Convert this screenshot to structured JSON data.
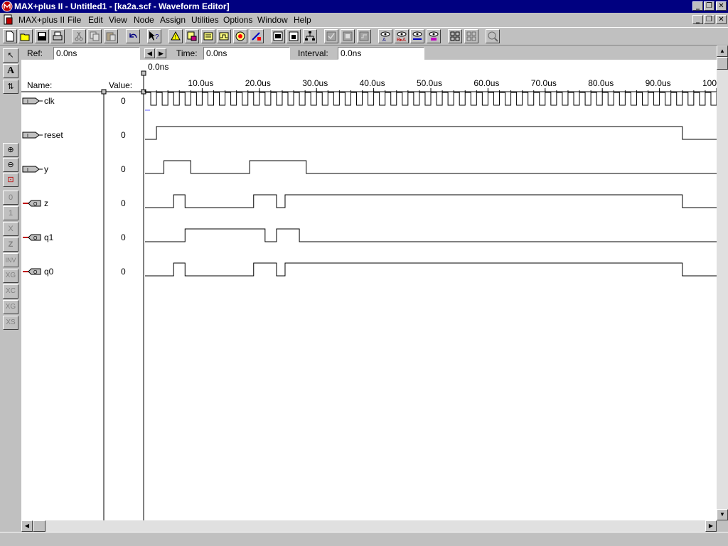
{
  "window": {
    "title": "MAX+plus II - Untitled1 - [ka2a.scf - Waveform Editor]",
    "minimize_label": "_",
    "restore_label": "❐",
    "close_label": "✕"
  },
  "menu": {
    "items": [
      "MAX+plus II",
      "File",
      "Edit",
      "View",
      "Node",
      "Assign",
      "Utilities",
      "Options",
      "Window",
      "Help"
    ]
  },
  "toolbar": {
    "icons": [
      "new-file-icon",
      "open-folder-icon",
      "save-icon",
      "print-icon",
      "cut-icon",
      "copy-icon",
      "paste-icon",
      "undo-icon",
      "context-help-icon",
      "hierarchy-up-icon",
      "find-node-icon",
      "compiler-icon",
      "simulator-icon",
      "timing-analyzer-icon",
      "programmer-icon",
      "floorplan-icon",
      "hierarchy-display-icon",
      "project-tree-icon",
      "save-check-icon",
      "save-compile-icon",
      "save-simulate-icon",
      "node-search-icon",
      "find-node-source-icon",
      "find-node-dest-icon",
      "find-clique-icon",
      "grid-icon",
      "grid-disabled-icon",
      "zoom-fit-icon"
    ]
  },
  "left_tools": {
    "labels": [
      "↖",
      "A",
      "⇅",
      "⊕",
      "⊖",
      "⊡",
      "0",
      "1",
      "X",
      "Z",
      "INV",
      "XG",
      "XC",
      "XG",
      "XS"
    ]
  },
  "fields": {
    "ref_label": "Ref:",
    "ref_value": "0.0ns",
    "time_label": "Time:",
    "time_value": "0.0ns",
    "interval_label": "Interval:",
    "interval_value": "0.0ns",
    "cursor_time": "0.0ns"
  },
  "columns": {
    "name_header": "Name:",
    "value_header": "Value:"
  },
  "timeline": {
    "ticks": [
      "10.0us",
      "20.0us",
      "30.0us",
      "40.0us",
      "50.0us",
      "60.0us",
      "70.0us",
      "80.0us",
      "90.0us",
      "100"
    ]
  },
  "nodes": [
    {
      "name": "clk",
      "value": "0",
      "type": "input"
    },
    {
      "name": "reset",
      "value": "0",
      "type": "input"
    },
    {
      "name": "y",
      "value": "0",
      "type": "input"
    },
    {
      "name": "z",
      "value": "0",
      "type": "output"
    },
    {
      "name": "q1",
      "value": "0",
      "type": "output"
    },
    {
      "name": "q0",
      "value": "0",
      "type": "output"
    }
  ],
  "chart_data": {
    "type": "line",
    "x_range_us": [
      0,
      100
    ],
    "clock_period_us": 2,
    "waveforms": {
      "reset": [
        [
          0,
          0
        ],
        [
          2,
          1
        ],
        [
          94,
          0
        ]
      ],
      "y": [
        [
          0,
          0
        ],
        [
          3.3,
          1
        ],
        [
          8,
          0
        ],
        [
          18.3,
          1
        ],
        [
          28.2,
          0
        ]
      ],
      "z": [
        [
          0,
          0
        ],
        [
          5,
          1
        ],
        [
          7,
          0
        ],
        [
          19,
          1
        ],
        [
          23,
          0
        ],
        [
          24.5,
          1
        ],
        [
          94,
          0
        ]
      ],
      "q1": [
        [
          0,
          0
        ],
        [
          7,
          1
        ],
        [
          21,
          0
        ],
        [
          23,
          1
        ],
        [
          27,
          0
        ]
      ],
      "q0": [
        [
          0,
          0
        ],
        [
          5,
          1
        ],
        [
          7,
          0
        ],
        [
          19,
          1
        ],
        [
          23,
          0
        ],
        [
          24.5,
          1
        ],
        [
          94,
          0
        ]
      ]
    }
  }
}
